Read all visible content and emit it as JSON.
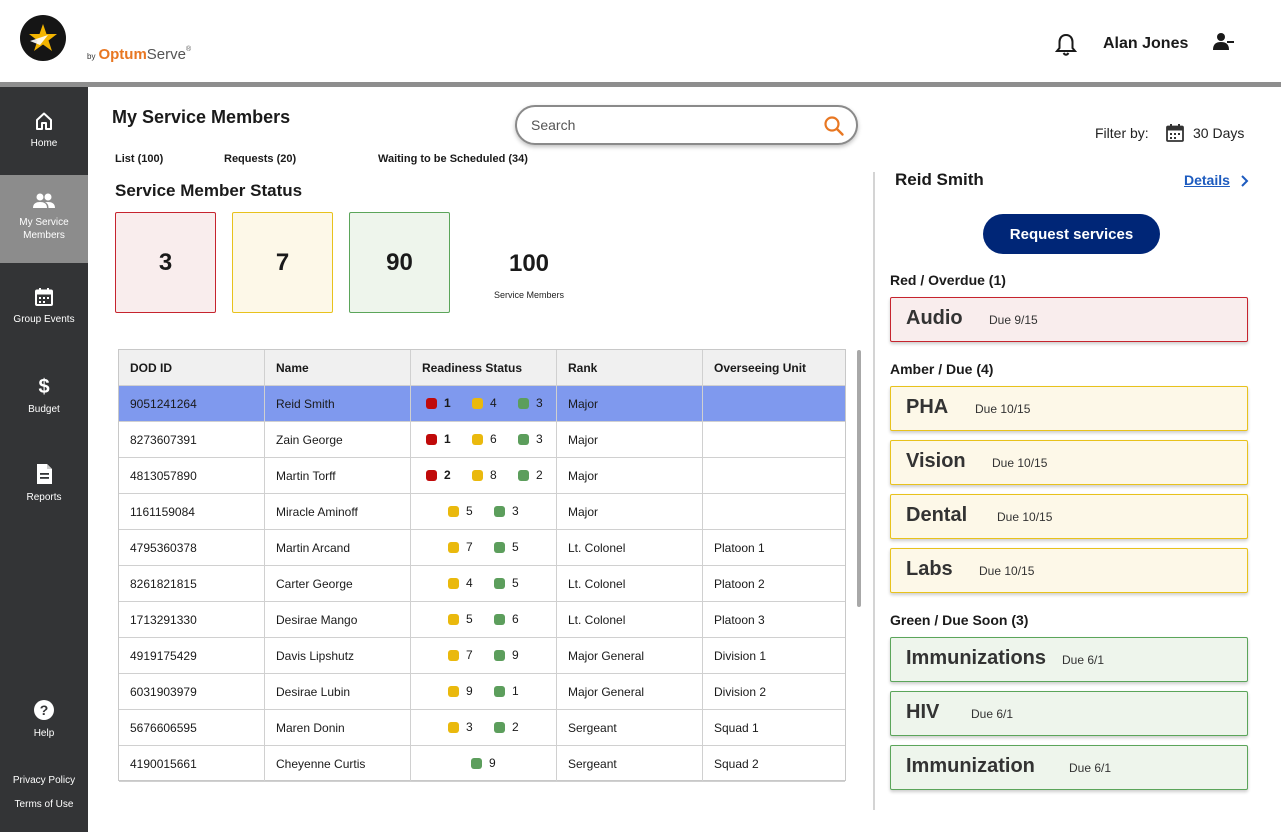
{
  "header": {
    "brand_by": "by",
    "brand_optum": "Optum",
    "brand_serve": "Serve",
    "brand_reg": "®",
    "user_name": "Alan Jones"
  },
  "sidebar": {
    "items": [
      {
        "label": "Home",
        "icon": "home-icon"
      },
      {
        "label": "My Service Members",
        "icon": "people-icon"
      },
      {
        "label": "Group Events",
        "icon": "calendar-icon"
      },
      {
        "label": "Budget",
        "icon": "dollar-icon"
      },
      {
        "label": "Reports",
        "icon": "document-icon"
      }
    ],
    "help": "Help",
    "privacy": "Privacy Policy",
    "terms": "Terms of Use"
  },
  "main": {
    "title": "My Service Members",
    "search_placeholder": "Search",
    "filter_label": "Filter by:",
    "filter_value": "30 Days",
    "tabs": [
      "List (100)",
      "Requests (20)",
      "Waiting to be Scheduled (34)"
    ],
    "status_title": "Service Member Status",
    "status": {
      "red": "3",
      "amber": "7",
      "green": "90",
      "total": "100",
      "total_label": "Service Members"
    },
    "colors": {
      "red": "#c00a0a",
      "amber": "#eab90d",
      "green": "#5c9e5c",
      "selected_row": "#7f99ee",
      "primary_button": "#002677",
      "link": "#1d5bbf"
    }
  },
  "table": {
    "columns": [
      "DOD ID",
      "Name",
      "Readiness Status",
      "Rank",
      "Overseeing Unit"
    ],
    "rows": [
      {
        "id": "9051241264",
        "name": "Reid Smith",
        "red": "1",
        "amber": "4",
        "green": "3",
        "rank": "Major",
        "unit": "",
        "selected": true
      },
      {
        "id": "8273607391",
        "name": "Zain George",
        "red": "1",
        "amber": "6",
        "green": "3",
        "rank": "Major",
        "unit": ""
      },
      {
        "id": "4813057890",
        "name": "Martin Torff",
        "red": "2",
        "amber": "8",
        "green": "2",
        "rank": "Major",
        "unit": ""
      },
      {
        "id": "1161159084",
        "name": "Miracle Aminoff",
        "red": "",
        "amber": "5",
        "green": "3",
        "rank": "Major",
        "unit": ""
      },
      {
        "id": "4795360378",
        "name": "Martin Arcand",
        "red": "",
        "amber": "7",
        "green": "5",
        "rank": "Lt. Colonel",
        "unit": "Platoon 1"
      },
      {
        "id": "8261821815",
        "name": "Carter George",
        "red": "",
        "amber": "4",
        "green": "5",
        "rank": "Lt. Colonel",
        "unit": "Platoon 2"
      },
      {
        "id": "1713291330",
        "name": "Desirae Mango",
        "red": "",
        "amber": "5",
        "green": "6",
        "rank": "Lt. Colonel",
        "unit": "Platoon 3"
      },
      {
        "id": "4919175429",
        "name": "Davis Lipshutz",
        "red": "",
        "amber": "7",
        "green": "9",
        "rank": "Major General",
        "unit": "Division 1"
      },
      {
        "id": "6031903979",
        "name": "Desirae Lubin",
        "red": "",
        "amber": "9",
        "green": "1",
        "rank": "Major General",
        "unit": "Division 2"
      },
      {
        "id": "5676606595",
        "name": "Maren Donin",
        "red": "",
        "amber": "3",
        "green": "2",
        "rank": "Sergeant",
        "unit": "Squad 1"
      },
      {
        "id": "4190015661",
        "name": "Cheyenne Curtis",
        "red": "",
        "amber": "",
        "green": "9",
        "rank": "Sergeant",
        "unit": "Squad 2"
      }
    ]
  },
  "panel": {
    "name": "Reid Smith",
    "details_link": "Details",
    "request_button": "Request services",
    "groups": [
      {
        "title": "Red / Overdue (1)",
        "color": "red",
        "items": [
          {
            "name": "Audio",
            "due": "Due 9/15"
          }
        ]
      },
      {
        "title": "Amber / Due (4)",
        "color": "amber",
        "items": [
          {
            "name": "PHA",
            "due": "Due 10/15"
          },
          {
            "name": "Vision",
            "due": "Due 10/15"
          },
          {
            "name": "Dental",
            "due": "Due 10/15"
          },
          {
            "name": "Labs",
            "due": "Due 10/15"
          }
        ]
      },
      {
        "title": "Green / Due Soon (3)",
        "color": "green",
        "items": [
          {
            "name": "Immunizations",
            "due": "Due 6/1"
          },
          {
            "name": "HIV",
            "due": "Due 6/1"
          },
          {
            "name": "Immunization",
            "due": "Due 6/1"
          }
        ]
      }
    ]
  }
}
